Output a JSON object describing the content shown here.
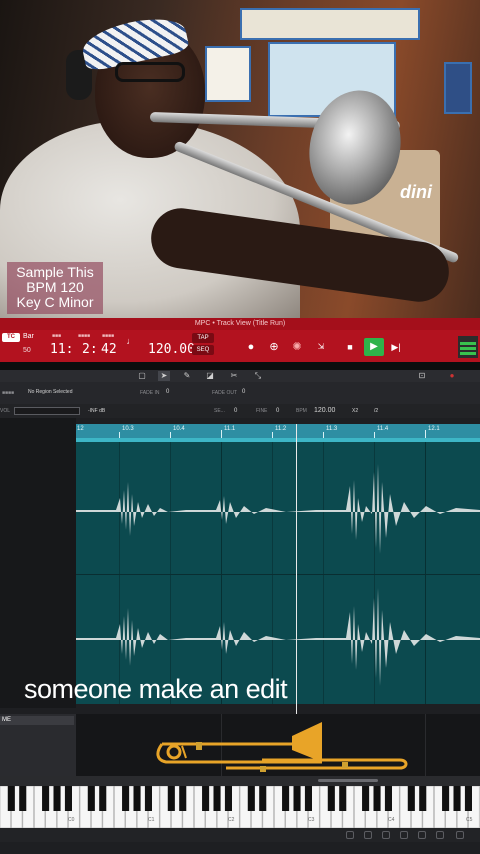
{
  "overlay": {
    "sample_line1": "Sample This",
    "sample_line2": "BPM 120",
    "sample_line3": "Key C Minor",
    "caption": "someone make an edit"
  },
  "scene": {
    "cooler_text": "dini"
  },
  "daw": {
    "window_title": "MPC • Track View (Title Run)",
    "time_format": "TC",
    "unit_label": "Bar",
    "unit_value": "50",
    "position_bar": "11:",
    "position_beat": "2:",
    "position_tick": "42",
    "bpm": "120.00",
    "tap_label": "TAP",
    "seq_label": "SEQ",
    "transport_icons": [
      "record-icon",
      "overdub-icon",
      "metronome-icon",
      "count-in-icon",
      "stop-icon",
      "play-icon",
      "play-start-icon"
    ],
    "region_label": "No Region Selected",
    "fade_in_label": "FADE IN",
    "fade_in_value": "0",
    "fade_out_label": "FADE OUT",
    "fade_out_value": "0",
    "volume_label": "VOL",
    "volume_value": "-INF dB",
    "semi_label": "SE...",
    "semi_value": "0",
    "fine_label": "FINE",
    "fine_value": "0",
    "bpm_label": "BPM",
    "bpm_value": "120.00",
    "half_label": "X2",
    "double_label": "/2",
    "ruler_labels": [
      "12",
      "10.3",
      "10.4",
      "11.1",
      "11.2",
      "11.3",
      "11.4",
      "12.1"
    ],
    "lower_track_name": "ME",
    "octave_labels": [
      "C0",
      "C1",
      "C2",
      "C3",
      "C4",
      "C5"
    ]
  },
  "colors": {
    "transport_red": "#b3121f",
    "waveform_teal": "#0c4a4f",
    "ruler_teal": "#2e8ea3",
    "play_green": "#2fb34a",
    "trombone_gold": "#e8a428"
  }
}
